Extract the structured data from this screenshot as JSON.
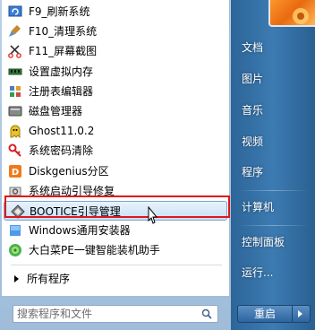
{
  "programs": [
    {
      "label": "F9_刷新系统",
      "icon": "refresh-icon"
    },
    {
      "label": "F10_清理系统",
      "icon": "broom-icon"
    },
    {
      "label": "F11_屏幕截图",
      "icon": "screenshot-icon"
    },
    {
      "label": "设置虚拟内存",
      "icon": "memory-icon"
    },
    {
      "label": "注册表编辑器",
      "icon": "registry-icon"
    },
    {
      "label": "磁盘管理器",
      "icon": "disk-icon"
    },
    {
      "label": "Ghost11.0.2",
      "icon": "ghost-icon"
    },
    {
      "label": "系统密码清除",
      "icon": "key-icon"
    },
    {
      "label": "Diskgenius分区",
      "icon": "diskgenius-icon"
    },
    {
      "label": "系统启动引导修复",
      "icon": "boot-repair-icon"
    },
    {
      "label": "BOOTICE引导管理",
      "icon": "bootice-icon",
      "selected": true
    },
    {
      "label": "Windows通用安装器",
      "icon": "installer-icon"
    },
    {
      "label": "大白菜PE一键智能装机助手",
      "icon": "cabbage-icon"
    }
  ],
  "all_programs": "所有程序",
  "search": {
    "placeholder": "搜索程序和文件"
  },
  "right_menu": {
    "documents": "文档",
    "pictures": "图片",
    "music": "音乐",
    "videos": "视频",
    "programs": "程序",
    "computer": "计算机",
    "control_panel": "控制面板",
    "run": "运行..."
  },
  "shutdown": {
    "label": "重启"
  },
  "colors": {
    "highlight_border": "#e01818",
    "accent": "#2d6598"
  }
}
